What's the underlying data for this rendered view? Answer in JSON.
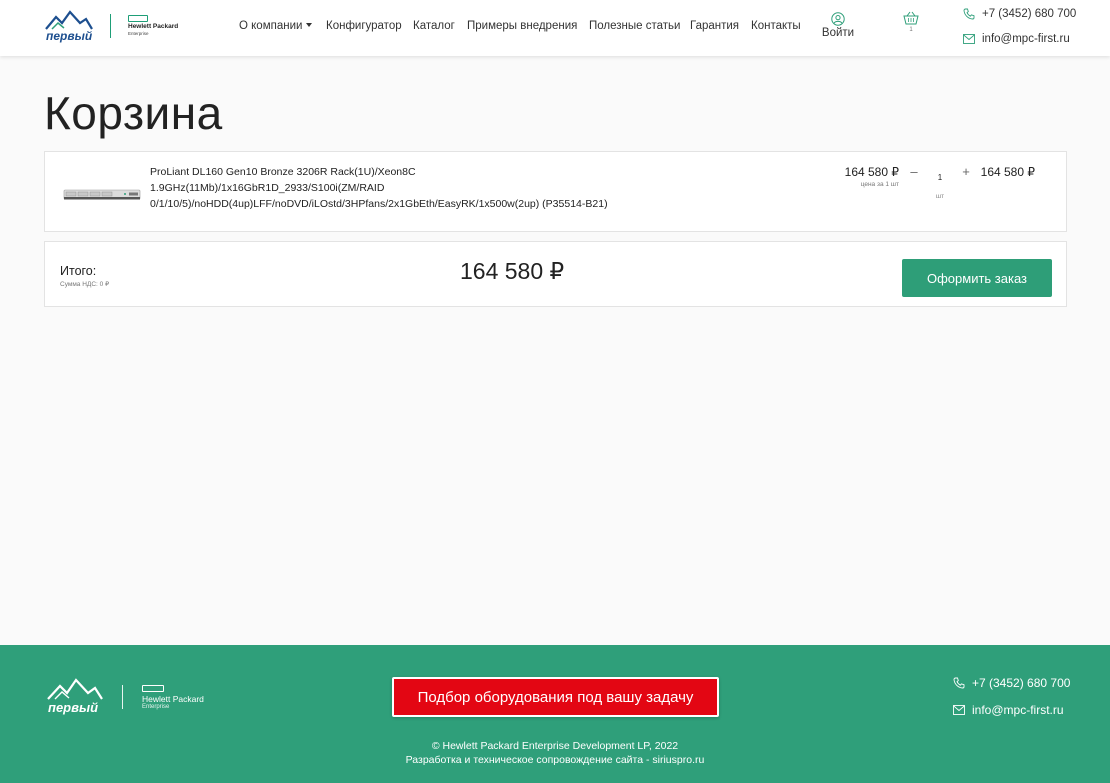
{
  "header": {
    "logo_text": "первый",
    "partner_name": "Hewlett Packard",
    "partner_sub": "Enterprise",
    "nav": [
      {
        "label": "О компании",
        "has_dropdown": true
      },
      {
        "label": "Конфигуратор"
      },
      {
        "label": "Каталог"
      },
      {
        "label": "Примеры внедрения"
      },
      {
        "label": "Полезные статьи"
      },
      {
        "label": "Гарантия"
      },
      {
        "label": "Контакты"
      }
    ],
    "login_label": "Войти",
    "cart_count": "1",
    "phone": "+7 (3452) 680 700",
    "email": "info@mpc-first.ru"
  },
  "page": {
    "title": "Корзина"
  },
  "cart": {
    "items": [
      {
        "name": "ProLiant DL160 Gen10 Bronze 3206R Rack(1U)/Xeon8C 1.9GHz(11Mb)/1x16GbR1D_2933/S100i(ZM/RAID 0/1/10/5)/noHDD(4up)LFF/noDVD/iLOstd/3HPfans/2x1GbEth/EasyRK/1x500w(2up) (P35514-B21)",
        "unit_price": "164 580 ₽",
        "unit_note": "цена за 1 шт",
        "quantity": "1",
        "qty_unit": "шт",
        "minus": "–",
        "plus": "+",
        "total": "164 580 ₽"
      }
    ],
    "summary": {
      "total_label": "Итого:",
      "vat_label": "Сумма НДС: 0 ₽",
      "total_amount": "164 580 ₽",
      "checkout_label": "Оформить заказ"
    }
  },
  "footer": {
    "logo_text": "первый",
    "partner_name": "Hewlett Packard",
    "partner_sub": "Enterprise",
    "cta_label": "Подбор оборудования под вашу задачу",
    "phone": "+7 (3452) 680 700",
    "email": "info@mpc-first.ru",
    "copyright": "© Hewlett Packard Enterprise Development LP, 2022",
    "developer": "Разработка и техническое сопровождение сайта - siriuspro.ru"
  },
  "colors": {
    "brand_green": "#2f9f7a",
    "cta_red": "#e30613",
    "logo_blue": "#1d4f8f"
  },
  "icons": [
    "user-icon",
    "basket-icon",
    "phone-icon",
    "mail-icon",
    "caret-down-icon"
  ]
}
